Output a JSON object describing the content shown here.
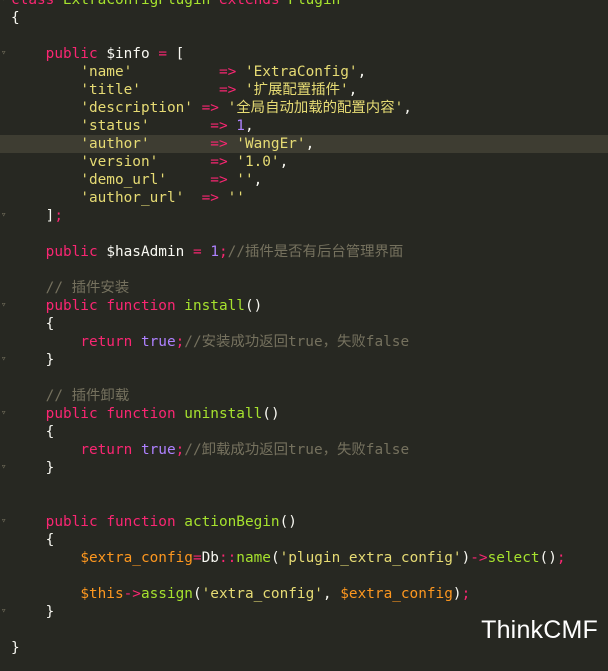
{
  "editor": {
    "lines": [
      {
        "tokens": [
          [
            "kw",
            "class"
          ],
          [
            "pl",
            " "
          ],
          [
            "cls",
            "ExtraConfigPlugin"
          ],
          [
            "pl",
            " "
          ],
          [
            "kw",
            "extends"
          ],
          [
            "pl",
            " "
          ],
          [
            "cls",
            "Plugin"
          ]
        ],
        "fold": true
      },
      {
        "tokens": [
          [
            "pl",
            "{"
          ]
        ]
      },
      {
        "tokens": [
          [
            "pl",
            ""
          ]
        ]
      },
      {
        "tokens": [
          [
            "pl",
            "    "
          ],
          [
            "kw",
            "public"
          ],
          [
            "pl",
            " "
          ],
          [
            "var",
            "$info"
          ],
          [
            "pl",
            " "
          ],
          [
            "op",
            "="
          ],
          [
            "pl",
            " ["
          ]
        ],
        "fold": true
      },
      {
        "tokens": [
          [
            "pl",
            "        "
          ],
          [
            "str",
            "'name'"
          ],
          [
            "pl",
            "          "
          ],
          [
            "op",
            "=>"
          ],
          [
            "pl",
            " "
          ],
          [
            "str",
            "'ExtraConfig'"
          ],
          [
            "pl",
            ","
          ]
        ]
      },
      {
        "tokens": [
          [
            "pl",
            "        "
          ],
          [
            "str",
            "'title'"
          ],
          [
            "pl",
            "         "
          ],
          [
            "op",
            "=>"
          ],
          [
            "pl",
            " "
          ],
          [
            "str",
            "'扩展配置插件'"
          ],
          [
            "pl",
            ","
          ]
        ]
      },
      {
        "tokens": [
          [
            "pl",
            "        "
          ],
          [
            "str",
            "'description'"
          ],
          [
            "pl",
            " "
          ],
          [
            "op",
            "=>"
          ],
          [
            "pl",
            " "
          ],
          [
            "str",
            "'全局自动加载的配置内容'"
          ],
          [
            "pl",
            ","
          ]
        ]
      },
      {
        "tokens": [
          [
            "pl",
            "        "
          ],
          [
            "str",
            "'status'"
          ],
          [
            "pl",
            "       "
          ],
          [
            "op",
            "=>"
          ],
          [
            "pl",
            " "
          ],
          [
            "num",
            "1"
          ],
          [
            "pl",
            ","
          ]
        ]
      },
      {
        "tokens": [
          [
            "pl",
            "        "
          ],
          [
            "str",
            "'author'"
          ],
          [
            "pl",
            "       "
          ],
          [
            "op",
            "=>"
          ],
          [
            "pl",
            " "
          ],
          [
            "str",
            "'WangEr'"
          ],
          [
            "pl",
            ","
          ]
        ],
        "active": true
      },
      {
        "tokens": [
          [
            "pl",
            "        "
          ],
          [
            "str",
            "'version'"
          ],
          [
            "pl",
            "      "
          ],
          [
            "op",
            "=>"
          ],
          [
            "pl",
            " "
          ],
          [
            "str",
            "'1.0'"
          ],
          [
            "pl",
            ","
          ]
        ]
      },
      {
        "tokens": [
          [
            "pl",
            "        "
          ],
          [
            "str",
            "'demo_url'"
          ],
          [
            "pl",
            "     "
          ],
          [
            "op",
            "=>"
          ],
          [
            "pl",
            " "
          ],
          [
            "str",
            "''"
          ],
          [
            "pl",
            ","
          ]
        ]
      },
      {
        "tokens": [
          [
            "pl",
            "        "
          ],
          [
            "str",
            "'author_url'"
          ],
          [
            "pl",
            "  "
          ],
          [
            "op",
            "=>"
          ],
          [
            "pl",
            " "
          ],
          [
            "str",
            "''"
          ]
        ]
      },
      {
        "tokens": [
          [
            "pl",
            "    ]"
          ],
          [
            "op",
            ";"
          ]
        ],
        "fold": true
      },
      {
        "tokens": [
          [
            "pl",
            ""
          ]
        ]
      },
      {
        "tokens": [
          [
            "pl",
            "    "
          ],
          [
            "kw",
            "public"
          ],
          [
            "pl",
            " "
          ],
          [
            "var",
            "$hasAdmin"
          ],
          [
            "pl",
            " "
          ],
          [
            "op",
            "="
          ],
          [
            "pl",
            " "
          ],
          [
            "num",
            "1"
          ],
          [
            "op",
            ";"
          ],
          [
            "cm",
            "//插件是否有后台管理界面"
          ]
        ]
      },
      {
        "tokens": [
          [
            "pl",
            ""
          ]
        ]
      },
      {
        "tokens": [
          [
            "pl",
            "    "
          ],
          [
            "cm",
            "// 插件安装"
          ]
        ]
      },
      {
        "tokens": [
          [
            "pl",
            "    "
          ],
          [
            "kw",
            "public"
          ],
          [
            "pl",
            " "
          ],
          [
            "kw",
            "function"
          ],
          [
            "pl",
            " "
          ],
          [
            "fn",
            "install"
          ],
          [
            "pl",
            "()"
          ]
        ],
        "fold": true
      },
      {
        "tokens": [
          [
            "pl",
            "    {"
          ]
        ]
      },
      {
        "tokens": [
          [
            "pl",
            "        "
          ],
          [
            "ret",
            "return"
          ],
          [
            "pl",
            " "
          ],
          [
            "const",
            "true"
          ],
          [
            "op",
            ";"
          ],
          [
            "cm",
            "//安装成功返回true，失败false"
          ]
        ]
      },
      {
        "tokens": [
          [
            "pl",
            "    }"
          ]
        ],
        "fold": true
      },
      {
        "tokens": [
          [
            "pl",
            ""
          ]
        ]
      },
      {
        "tokens": [
          [
            "pl",
            "    "
          ],
          [
            "cm",
            "// 插件卸载"
          ]
        ]
      },
      {
        "tokens": [
          [
            "pl",
            "    "
          ],
          [
            "kw",
            "public"
          ],
          [
            "pl",
            " "
          ],
          [
            "kw",
            "function"
          ],
          [
            "pl",
            " "
          ],
          [
            "fn",
            "uninstall"
          ],
          [
            "pl",
            "()"
          ]
        ],
        "fold": true
      },
      {
        "tokens": [
          [
            "pl",
            "    {"
          ]
        ]
      },
      {
        "tokens": [
          [
            "pl",
            "        "
          ],
          [
            "ret",
            "return"
          ],
          [
            "pl",
            " "
          ],
          [
            "const",
            "true"
          ],
          [
            "op",
            ";"
          ],
          [
            "cm",
            "//卸载成功返回true，失败false"
          ]
        ]
      },
      {
        "tokens": [
          [
            "pl",
            "    }"
          ]
        ],
        "fold": true
      },
      {
        "tokens": [
          [
            "pl",
            ""
          ]
        ]
      },
      {
        "tokens": [
          [
            "pl",
            ""
          ]
        ]
      },
      {
        "tokens": [
          [
            "pl",
            "    "
          ],
          [
            "kw",
            "public"
          ],
          [
            "pl",
            " "
          ],
          [
            "kw",
            "function"
          ],
          [
            "pl",
            " "
          ],
          [
            "fn",
            "actionBegin"
          ],
          [
            "pl",
            "()"
          ]
        ],
        "fold": true
      },
      {
        "tokens": [
          [
            "pl",
            "    {"
          ]
        ]
      },
      {
        "tokens": [
          [
            "pl",
            "        "
          ],
          [
            "thisv",
            "$extra_config"
          ],
          [
            "op",
            "="
          ],
          [
            "pl",
            "Db"
          ],
          [
            "op",
            "::"
          ],
          [
            "fn",
            "name"
          ],
          [
            "pl",
            "("
          ],
          [
            "str",
            "'plugin_extra_config'"
          ],
          [
            "pl",
            ")"
          ],
          [
            "op",
            "->"
          ],
          [
            "fn",
            "select"
          ],
          [
            "pl",
            "()"
          ],
          [
            "op",
            ";"
          ]
        ]
      },
      {
        "tokens": [
          [
            "pl",
            ""
          ]
        ]
      },
      {
        "tokens": [
          [
            "pl",
            "        "
          ],
          [
            "thisv",
            "$this"
          ],
          [
            "op",
            "->"
          ],
          [
            "fn",
            "assign"
          ],
          [
            "pl",
            "("
          ],
          [
            "str",
            "'extra_config'"
          ],
          [
            "pl",
            ", "
          ],
          [
            "thisv",
            "$extra_config"
          ],
          [
            "pl",
            ")"
          ],
          [
            "op",
            ";"
          ]
        ]
      },
      {
        "tokens": [
          [
            "pl",
            "    }"
          ]
        ],
        "fold": true
      },
      {
        "tokens": [
          [
            "pl",
            ""
          ]
        ]
      },
      {
        "tokens": [
          [
            "pl",
            "}"
          ]
        ]
      }
    ]
  },
  "watermark": {
    "text": "ThinkCMF"
  }
}
